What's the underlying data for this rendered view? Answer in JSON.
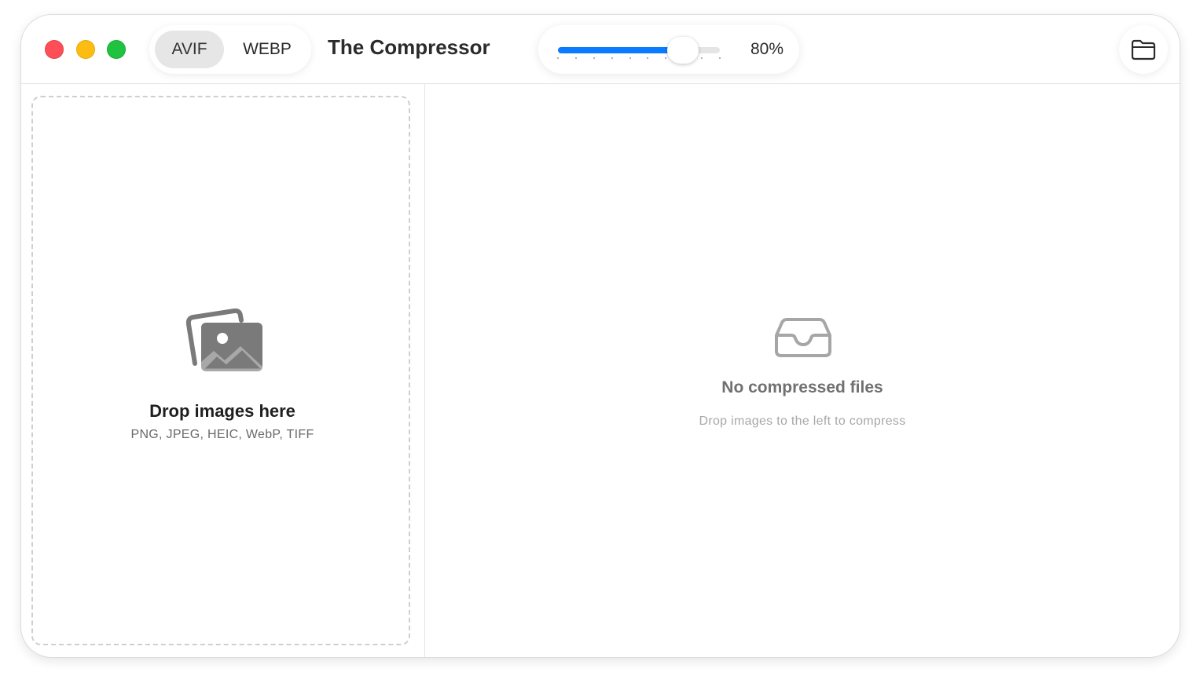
{
  "window": {
    "controls": [
      "close",
      "minimize",
      "zoom"
    ],
    "colors": {
      "close": "#fe4f58",
      "minimize": "#fdbc12",
      "zoom": "#20c33f"
    }
  },
  "toolbar": {
    "formats": [
      {
        "label": "AVIF",
        "selected": true
      },
      {
        "label": "WEBP",
        "selected": false
      }
    ],
    "title": "The Compressor",
    "quality": {
      "value_percent": 80,
      "label": "80%",
      "accent_color": "#0a7bff",
      "tick_count": 10
    },
    "open_folder_icon": "folder-icon"
  },
  "dropzone": {
    "icon": "photos-icon",
    "title": "Drop images here",
    "formats": "PNG, JPEG, HEIC, WebP, TIFF"
  },
  "results": {
    "icon": "tray-icon",
    "title": "No compressed files",
    "subtitle": "Drop images to the left to compress"
  }
}
